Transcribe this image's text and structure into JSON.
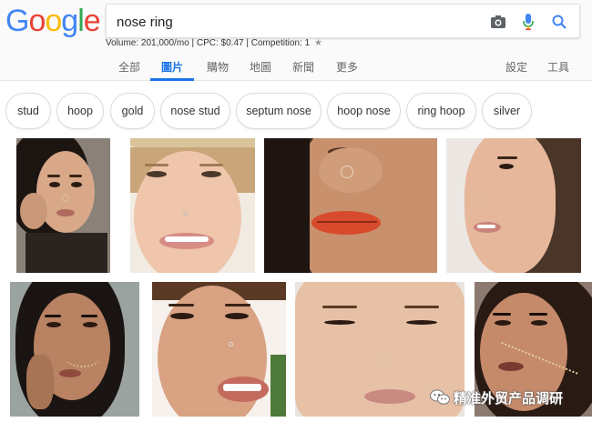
{
  "logo": {
    "letters": [
      "G",
      "o",
      "o",
      "g",
      "l",
      "e"
    ],
    "colors": [
      "#4285f4",
      "#ea4335",
      "#fbbc05",
      "#4285f4",
      "#34a853",
      "#ea4335"
    ]
  },
  "search": {
    "query": "nose ring",
    "camera_icon": "camera-icon",
    "mic_icon": "microphone-icon",
    "search_icon": "search-icon"
  },
  "metrics": {
    "text": "Volume: 201,000/mo | CPC: $0.47 | Competition: 1",
    "star_icon": "star-icon"
  },
  "tabs": [
    {
      "label": "全部",
      "active": false
    },
    {
      "label": "圖片",
      "active": true
    },
    {
      "label": "購物",
      "active": false
    },
    {
      "label": "地圖",
      "active": false
    },
    {
      "label": "新聞",
      "active": false
    },
    {
      "label": "更多",
      "active": false
    }
  ],
  "tools": {
    "settings": "設定",
    "tools": "工具"
  },
  "chips": [
    "stud",
    "hoop",
    "gold",
    "nose stud",
    "septum nose",
    "hoop nose",
    "ring hoop",
    "silver"
  ],
  "images": [
    {
      "alt": "woman with nose ring, hand on face",
      "row": 1
    },
    {
      "alt": "smiling woman with nose stud and straw hat",
      "row": 1
    },
    {
      "alt": "close-up of nose with hoop and red lips",
      "row": 1
    },
    {
      "alt": "profile of woman with nose hoop",
      "row": 1
    },
    {
      "alt": "woman with nose chain, hand on cheek",
      "row": 2
    },
    {
      "alt": "smiling woman with small nose stud",
      "row": 2
    },
    {
      "alt": "woman looking down with nose hoop",
      "row": 2
    },
    {
      "alt": "woman with nose chain to ear",
      "row": 2
    }
  ],
  "watermark": {
    "text": "精准外贸产品调研",
    "icon": "wechat-icon"
  },
  "colors": {
    "accent": "#1a73e8",
    "chip_border": "#dadce0"
  }
}
